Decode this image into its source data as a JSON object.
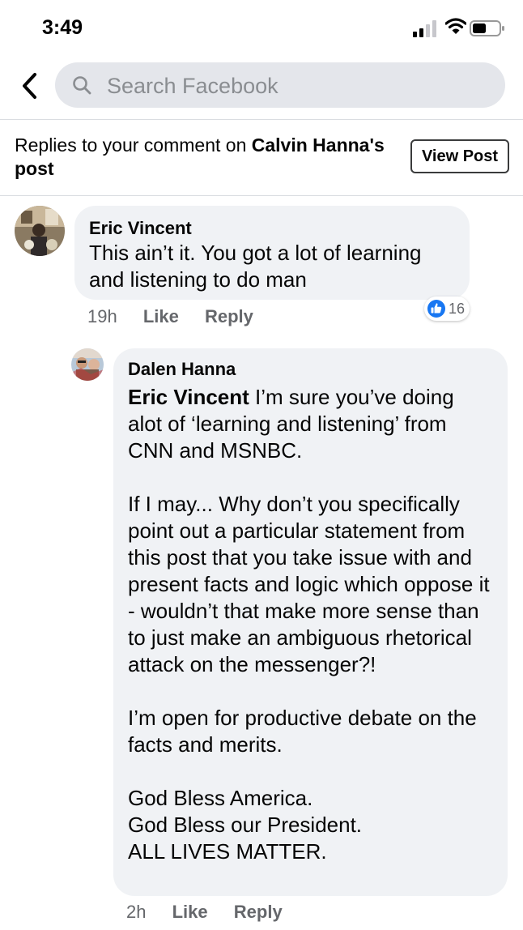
{
  "status_bar": {
    "time": "3:49"
  },
  "search": {
    "placeholder": "Search Facebook"
  },
  "header": {
    "prefix": "Replies to your comment on ",
    "post_owner": "Calvin Hanna",
    "suffix": "'s post",
    "view_post_label": "View Post"
  },
  "comments": [
    {
      "author": "Eric Vincent",
      "text": "This ain’t it. You got a lot of learning and listening to do man",
      "time": "19h",
      "like_label": "Like",
      "reply_label": "Reply",
      "reaction_count": "16"
    },
    {
      "author": "Dalen Hanna",
      "mention": "Eric Vincent",
      "text": " I’m sure you’ve doing alot of ‘learning and listening’ from CNN and MSNBC.\n\nIf I may... Why don’t you specifically point out a particular statement from this post that you take issue with and present facts and logic which oppose it - wouldn’t that make more sense than to just make an ambiguous rhetorical attack on the messenger?!\n\nI’m open for productive debate on the facts and merits.\n\nGod Bless America.\nGod Bless our President.\nALL LIVES MATTER.",
      "time": "2h",
      "like_label": "Like",
      "reply_label": "Reply"
    }
  ],
  "colors": {
    "bubble": "#f0f2f5",
    "meta_text": "#65676b",
    "like_blue": "#1877f2",
    "search_bg": "#e4e6eb"
  },
  "icons": [
    "signal-icon",
    "wifi-icon",
    "battery-icon",
    "back-icon",
    "search-icon",
    "like-reaction-icon"
  ]
}
